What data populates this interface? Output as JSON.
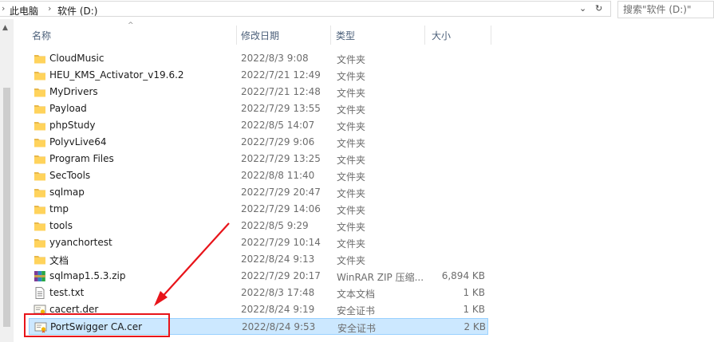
{
  "address_bar": {
    "crumbs": [
      "此电脑",
      "软件 (D:)"
    ],
    "separator": "›",
    "dropdown_glyph": "⌄",
    "refresh_glyph": "↻"
  },
  "search": {
    "placeholder": "搜索\"软件 (D:)\""
  },
  "columns": {
    "name": "名称",
    "date": "修改日期",
    "type": "类型",
    "size": "大小"
  },
  "sort_arrow": "^",
  "files": [
    {
      "name": "CloudMusic",
      "date": "2022/8/3 9:08",
      "type": "文件夹",
      "size": "",
      "icon": "folder-icon"
    },
    {
      "name": "HEU_KMS_Activator_v19.6.2",
      "date": "2022/7/21 12:49",
      "type": "文件夹",
      "size": "",
      "icon": "folder-icon"
    },
    {
      "name": "MyDrivers",
      "date": "2022/7/21 12:48",
      "type": "文件夹",
      "size": "",
      "icon": "folder-icon"
    },
    {
      "name": "Payload",
      "date": "2022/7/29 13:55",
      "type": "文件夹",
      "size": "",
      "icon": "folder-icon"
    },
    {
      "name": "phpStudy",
      "date": "2022/8/5 14:07",
      "type": "文件夹",
      "size": "",
      "icon": "folder-icon"
    },
    {
      "name": "PolyvLive64",
      "date": "2022/7/29 9:06",
      "type": "文件夹",
      "size": "",
      "icon": "folder-icon"
    },
    {
      "name": "Program Files",
      "date": "2022/7/29 13:25",
      "type": "文件夹",
      "size": "",
      "icon": "folder-icon"
    },
    {
      "name": "SecTools",
      "date": "2022/8/8 11:40",
      "type": "文件夹",
      "size": "",
      "icon": "folder-icon"
    },
    {
      "name": "sqlmap",
      "date": "2022/7/29 20:47",
      "type": "文件夹",
      "size": "",
      "icon": "folder-icon"
    },
    {
      "name": "tmp",
      "date": "2022/7/29 14:06",
      "type": "文件夹",
      "size": "",
      "icon": "folder-icon"
    },
    {
      "name": "tools",
      "date": "2022/8/5 9:29",
      "type": "文件夹",
      "size": "",
      "icon": "folder-icon"
    },
    {
      "name": "yyanchortest",
      "date": "2022/7/29 10:14",
      "type": "文件夹",
      "size": "",
      "icon": "folder-icon"
    },
    {
      "name": "文档",
      "date": "2022/8/24 9:13",
      "type": "文件夹",
      "size": "",
      "icon": "folder-icon"
    },
    {
      "name": "sqlmap1.5.3.zip",
      "date": "2022/7/29 20:17",
      "type": "WinRAR ZIP 压缩...",
      "size": "6,894 KB",
      "icon": "winrar-archive-icon"
    },
    {
      "name": "test.txt",
      "date": "2022/8/3 17:48",
      "type": "文本文档",
      "size": "1 KB",
      "icon": "text-file-icon"
    },
    {
      "name": "cacert.der",
      "date": "2022/8/24 9:19",
      "type": "安全证书",
      "size": "1 KB",
      "icon": "certificate-icon"
    },
    {
      "name": "PortSwigger CA.cer",
      "date": "2022/8/24 9:53",
      "type": "安全证书",
      "size": "2 KB",
      "icon": "certificate-icon",
      "selected": true
    }
  ],
  "colors": {
    "selection_bg": "#cce8ff",
    "selection_border": "#99d1ff",
    "annotation_red": "#e8141a",
    "folder_yellow": "#ffd35c"
  }
}
